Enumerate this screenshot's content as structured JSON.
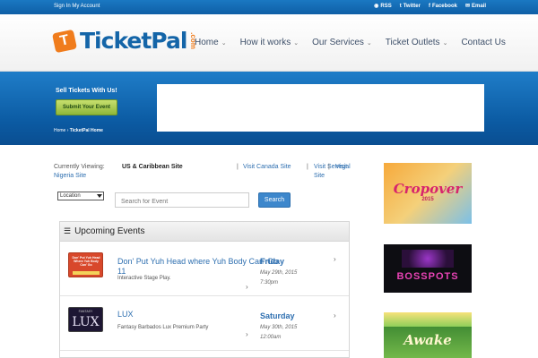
{
  "topbar": {
    "account_label": "Sign In My Account",
    "links": [
      {
        "icon": "rss-icon",
        "label": "RSS"
      },
      {
        "icon": "twitter-icon",
        "label": "Twitter"
      },
      {
        "icon": "facebook-icon",
        "label": "Facebook"
      },
      {
        "icon": "email-icon",
        "label": "Email"
      }
    ]
  },
  "header": {
    "logo_letter": "T",
    "logo_text": "TicketPal",
    "logo_suffix": ".com",
    "nav": [
      {
        "label": "Home",
        "has_dropdown": true
      },
      {
        "label": "How it works",
        "has_dropdown": true
      },
      {
        "label": "Our Services",
        "has_dropdown": true
      },
      {
        "label": "Ticket Outlets",
        "has_dropdown": true
      },
      {
        "label": "Contact Us",
        "has_dropdown": false
      }
    ]
  },
  "banner": {
    "sell_heading": "Sell Tickets With Us!",
    "submit_label": "Submit Your Event",
    "breadcrumb_home": "Home",
    "breadcrumb_sep": "›",
    "breadcrumb_current": "TicketPal Home"
  },
  "viewing": {
    "label": "Currently Viewing:",
    "current": "US & Caribbean Site",
    "sep": "|",
    "links": [
      "Visit Canada Site",
      "Visit Senegal Site",
      "Visit",
      "Nigeria Site"
    ]
  },
  "filter": {
    "location_value": "Location",
    "search_placeholder": "Search for Event",
    "search_button": "Search"
  },
  "events": {
    "heading": "Upcoming Events",
    "items": [
      {
        "title": "Don' Put Yuh Head where Yuh Body Can' Go 11",
        "description": "Interactive Stage Play.",
        "day": "Friday",
        "date": "May 29th, 2015",
        "time": "7:30pm",
        "thumb_text": "Don' Put Yuh Head Where Yuh Body Can' Go"
      },
      {
        "title": "LUX",
        "description": "Fantasy Barbados Lux Premium Party",
        "day": "Saturday",
        "date": "May 30th, 2015",
        "time": "12:00am",
        "thumb_top": "FANTASY",
        "thumb_main": "LUX"
      }
    ]
  },
  "sidebar_ads": [
    {
      "text": "Cropover",
      "sub": "2015"
    },
    {
      "text": "BOSSPOTS"
    },
    {
      "text": "Awake"
    }
  ],
  "colors": {
    "brand_blue": "#1465a8",
    "brand_orange": "#f07c1c",
    "link_blue": "#2e6fb0",
    "submit_green": "#8fb73a"
  }
}
